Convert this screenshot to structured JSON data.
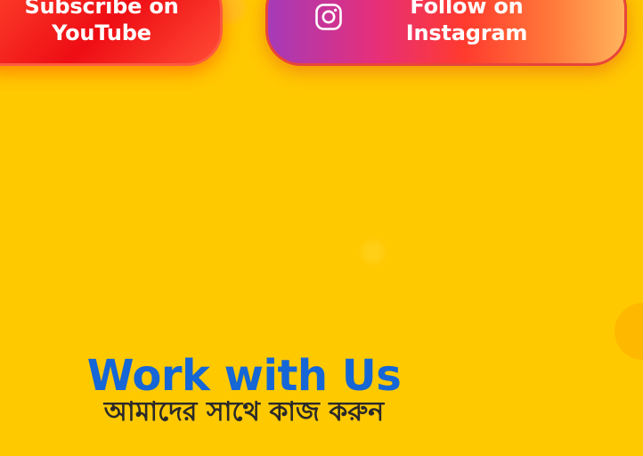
{
  "social": {
    "youtube": {
      "label_line1": "Subscribe on",
      "label_line2": "YouTube"
    },
    "instagram": {
      "icon": "instagram-icon",
      "label_line1": "Follow on",
      "label_line2": "Instagram"
    }
  },
  "work": {
    "title": "Work with Us",
    "subtitle": "আমাদের সাথে কাজ করুন"
  },
  "colors": {
    "background": "#ffc900",
    "title": "#1566d6",
    "subtitle": "#2a2a2a",
    "youtube_button": "#ee0d14",
    "instagram_gradient": [
      "#a53ab8",
      "#ff3a2e",
      "#ffb35c"
    ]
  }
}
